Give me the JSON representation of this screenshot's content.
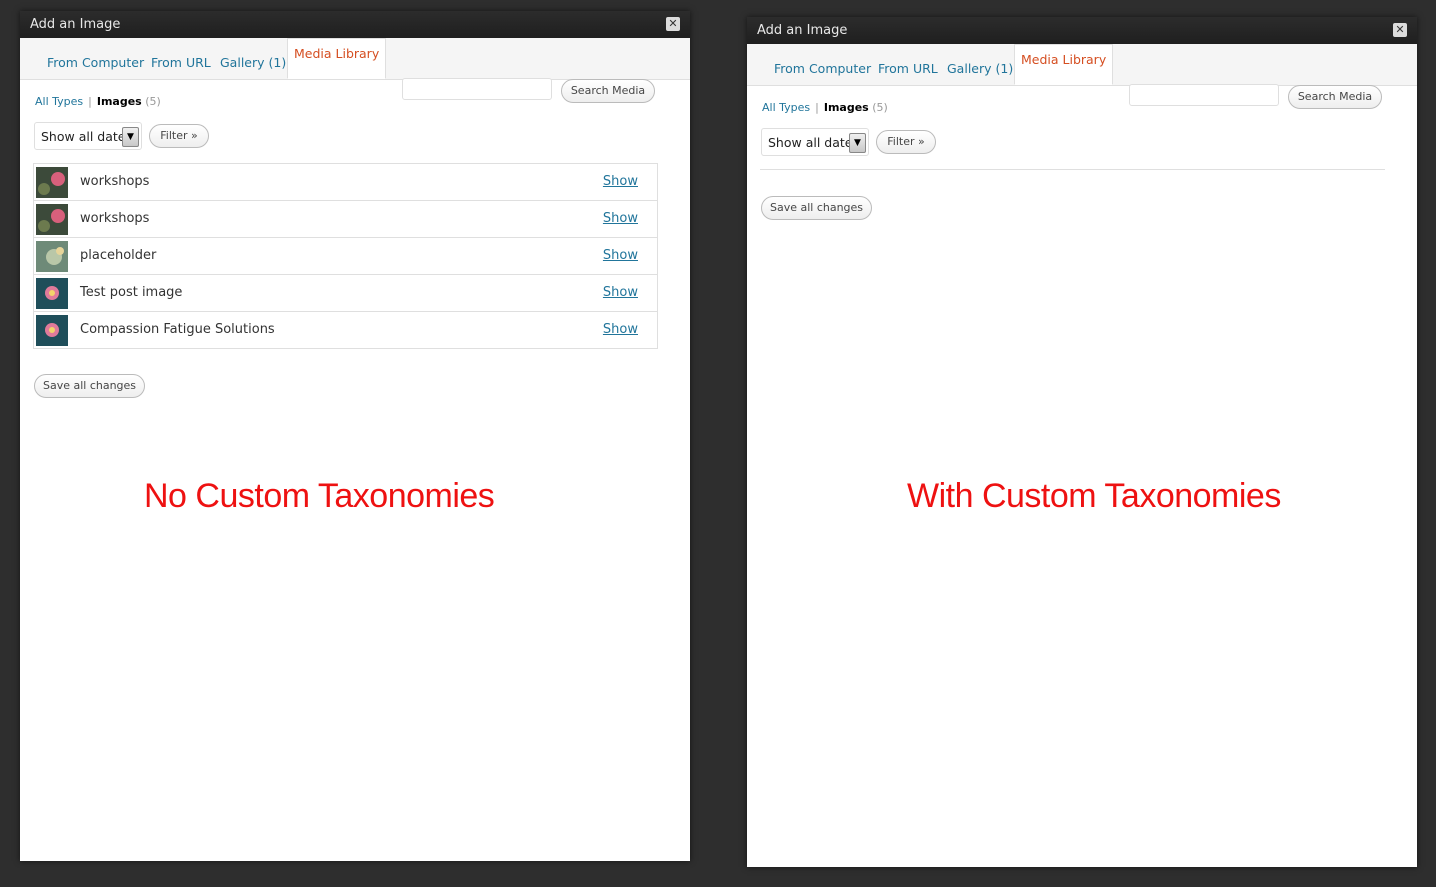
{
  "left_modal": {
    "title": "Add an Image",
    "close_glyph": "✕",
    "tabs": [
      "From Computer",
      "From URL",
      "Gallery (1)",
      "Media Library"
    ],
    "filters": {
      "all_types": "All Types",
      "separator": "|",
      "images": "Images",
      "images_count": "(5)"
    },
    "search_button": "Search Media",
    "date_select": "Show all dates",
    "filter_button": "Filter »",
    "items": [
      {
        "title": "workshops",
        "action": "Show"
      },
      {
        "title": "workshops",
        "action": "Show"
      },
      {
        "title": "placeholder",
        "action": "Show"
      },
      {
        "title": "Test post image",
        "action": "Show"
      },
      {
        "title": "Compassion Fatigue Solutions",
        "action": "Show"
      }
    ],
    "save_button": "Save all changes",
    "caption": "No Custom Taxonomies"
  },
  "right_modal": {
    "title": "Add an Image",
    "close_glyph": "✕",
    "tabs": [
      "From Computer",
      "From URL",
      "Gallery (1)",
      "Media Library"
    ],
    "filters": {
      "all_types": "All Types",
      "separator": "|",
      "images": "Images",
      "images_count": "(5)"
    },
    "search_button": "Search Media",
    "date_select": "Show all dates",
    "filter_button": "Filter »",
    "save_button": "Save all changes",
    "caption": "With Custom Taxonomies"
  },
  "colors": {
    "link": "#21759b",
    "active_tab": "#d54e21",
    "caption": "#ee1111"
  }
}
